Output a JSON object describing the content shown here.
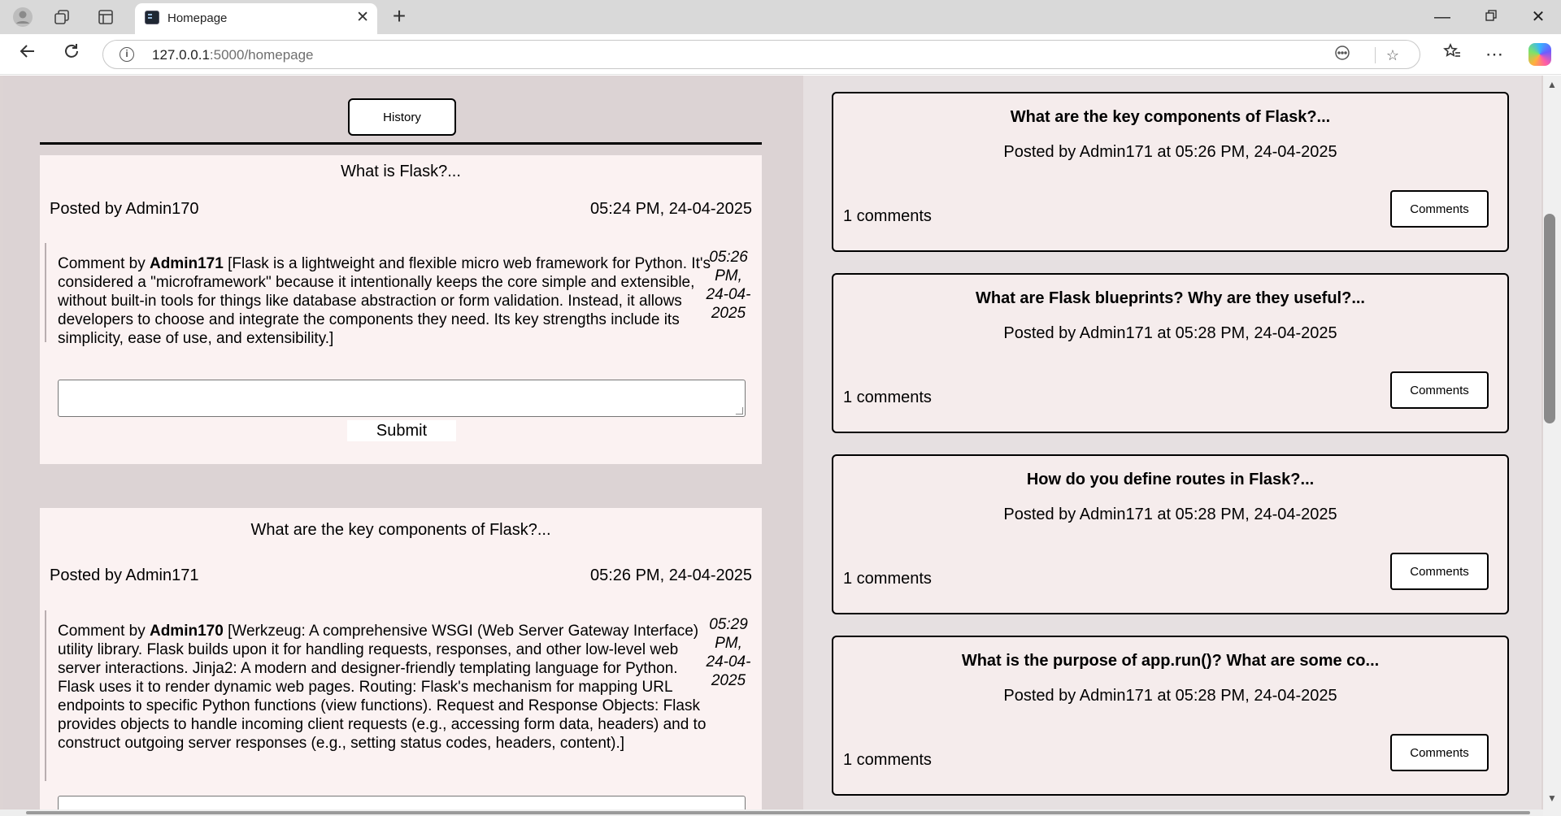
{
  "browser": {
    "tab_title": "Homepage",
    "url_host": "127.0.0.1",
    "url_path": ":5000/homepage"
  },
  "icons": {
    "profile": "profile-icon",
    "workspaces": "workspaces-icon",
    "tab_actions": "tab-actions-icon",
    "site_info": "site-info-icon",
    "read_aloud": "read-aloud-icon",
    "favorite": "star-icon",
    "favorites": "favorites-icon",
    "more": "more-icon",
    "copilot": "copilot-icon"
  },
  "left": {
    "history_label": "History",
    "submit_label": "Submit",
    "questions": [
      {
        "title": "What is Flask?...",
        "posted_by": "Posted by Admin170",
        "time": "05:24 PM, 24-04-2025",
        "comment": {
          "prefix": "Comment by ",
          "author": "Admin171",
          "text": " [Flask is a lightweight and flexible micro web framework for Python. It's considered a \"microframework\" because it intentionally keeps the core simple and extensible, without built-in tools for things like database abstraction or form validation. Instead, it allows developers to choose and integrate the components they need. Its key strengths include its simplicity, ease of use, and extensibility.]",
          "time": "05:26 PM, 24-04-2025"
        }
      },
      {
        "title": "What are the key components of Flask?...",
        "posted_by": "Posted by Admin171",
        "time": "05:26 PM, 24-04-2025",
        "comment": {
          "prefix": "Comment by ",
          "author": "Admin170",
          "text": " [Werkzeug: A comprehensive WSGI (Web Server Gateway Interface) utility library. Flask builds upon it for handling requests, responses, and other low-level web server interactions. Jinja2: A modern and designer-friendly templating language for Python. Flask uses it to render dynamic web pages. Routing: Flask's mechanism for mapping URL endpoints to specific Python functions (view functions). Request and Response Objects: Flask provides objects to handle incoming client requests (e.g., accessing form data, headers) and to construct outgoing server responses (e.g., setting status codes, headers, content).]",
          "time": "05:29 PM, 24-04-2025"
        }
      }
    ]
  },
  "right": {
    "comments_button_label": "Comments",
    "posts": [
      {
        "title": "What are the key components of Flask?...",
        "meta": "Posted by Admin171 at 05:26 PM, 24-04-2025",
        "count": "1 comments"
      },
      {
        "title": "What are Flask blueprints? Why are they useful?...",
        "meta": "Posted by Admin171 at 05:28 PM, 24-04-2025",
        "count": "1 comments"
      },
      {
        "title": "How do you define routes in Flask?...",
        "meta": "Posted by Admin171 at 05:28 PM, 24-04-2025",
        "count": "1 comments"
      },
      {
        "title": "What is the purpose of app.run()? What are some co...",
        "meta": "Posted by Admin171 at 05:28 PM, 24-04-2025",
        "count": "1 comments"
      }
    ]
  }
}
